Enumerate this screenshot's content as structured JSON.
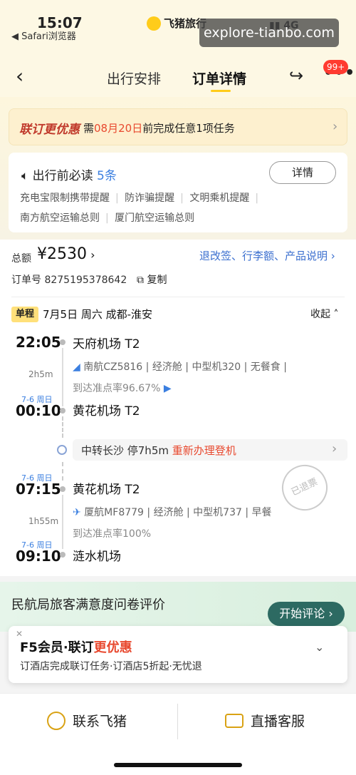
{
  "status_bar": {
    "time": "15:07",
    "back_app": "◀ Safari浏览器",
    "network": "4G"
  },
  "brand": {
    "name": "飞猪旅行"
  },
  "watermark": "explore-tianbo.com",
  "nav": {
    "tab_arrange": "出行安排",
    "tab_order": "订单详情",
    "badge": "99+"
  },
  "promo": {
    "strong": "联订更优惠",
    "prefix": "需",
    "date": "08月20日",
    "suffix": "前完成任意1项任务"
  },
  "notice": {
    "title": "出行前必读",
    "count": "5条",
    "detail_button": "详情",
    "tags": [
      "充电宝限制携带提醒",
      "防诈骗提醒",
      "文明乘机提醒",
      "南方航空运输总则",
      "厦门航空运输总则"
    ]
  },
  "order": {
    "total_label": "总额",
    "total_amount": "¥2530",
    "links": "退改签、行李额、产品说明",
    "order_no": "订单号 8275195378642",
    "copy": "复制"
  },
  "trip": {
    "type": "单程",
    "header": "7月5日  周六  成都-淮安",
    "collapse": "收起",
    "seg1": {
      "dep_time": "22:05",
      "dep_airport": "天府机场 T2",
      "duration": "2h5m",
      "flight": "南航CZ5816 | 经济舱 | 中型机320 | 无餐食 |",
      "ontime": "到达准点率96.67%",
      "arr_date": "7-6 周日",
      "arr_time": "00:10",
      "arr_airport": "黄花机场 T2"
    },
    "transfer": {
      "text": "中转长沙  停7h5m",
      "warn": "重新办理登机"
    },
    "seg2": {
      "dep_date": "7-6 周日",
      "dep_time": "07:15",
      "dep_airport": "黄花机场 T2",
      "duration": "1h55m",
      "flight": "厦航MF8779 | 经济舱 | 中型机737 | 早餐",
      "ontime": "到达准点率100%",
      "arr_date": "7-6 周日",
      "arr_time": "09:10",
      "arr_airport": "涟水机场"
    },
    "stamp": "已退票"
  },
  "survey": {
    "title": "民航局旅客满意度问卷评价",
    "button": "开始评论"
  },
  "f5": {
    "title_main": "F5会员·联订",
    "title_hl": "更优惠",
    "sub": "订酒店完成联订任务·订酒店5折起·无忧退"
  },
  "bottom": {
    "contact": "联系飞猪",
    "live": "直播客服"
  },
  "colors": {
    "accent": "#ffcc1a",
    "link": "#3b6fcf",
    "warn": "#e8492f",
    "survey_btn": "#2d6a62"
  }
}
